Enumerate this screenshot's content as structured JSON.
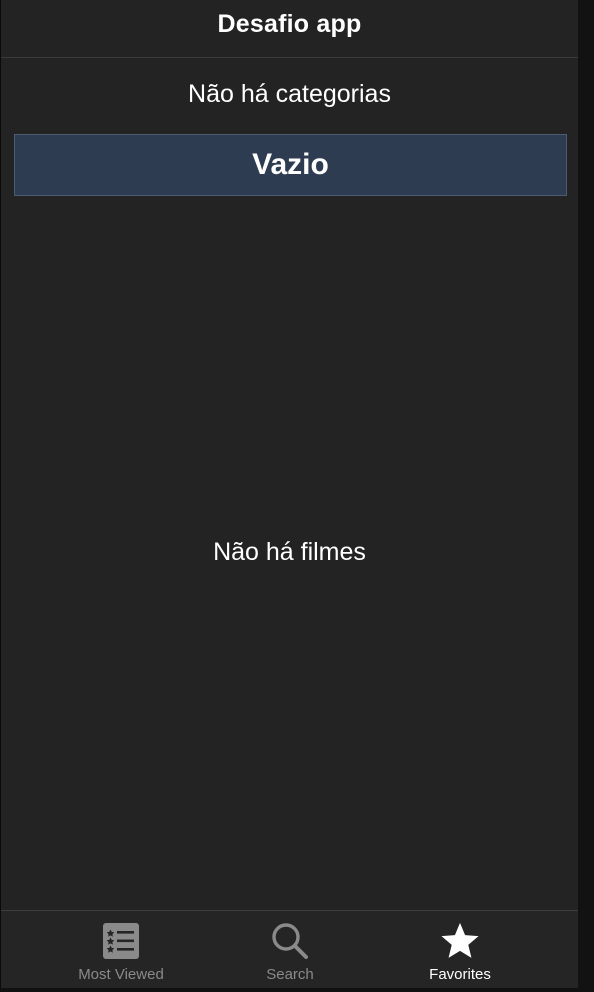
{
  "nav": {
    "title": "Desafio app"
  },
  "categories": {
    "empty_message": "Não há categorias",
    "selected_label": "Vazio"
  },
  "movies": {
    "empty_message": "Não há filmes"
  },
  "tabbar": {
    "items": [
      {
        "label": "Most Viewed",
        "icon": "list-icon",
        "active": false
      },
      {
        "label": "Search",
        "icon": "search-icon",
        "active": false
      },
      {
        "label": "Favorites",
        "icon": "star-icon",
        "active": true
      }
    ]
  },
  "colors": {
    "background": "#232323",
    "selected_category_bg": "#2d3c50",
    "inactive_tab": "#8a8a8a",
    "active_tab": "#ffffff"
  }
}
